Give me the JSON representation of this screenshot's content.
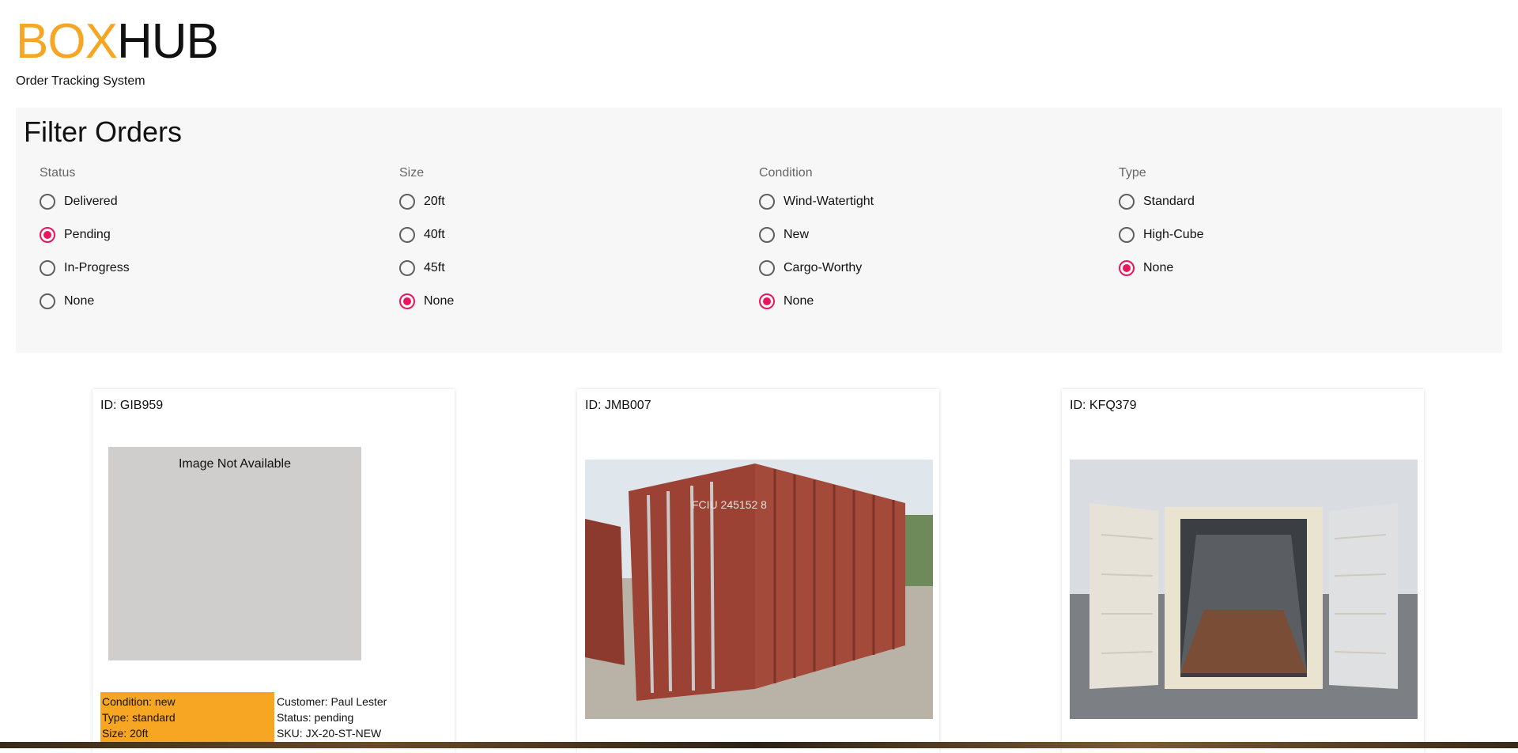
{
  "brand": {
    "logo_part1": "BOX",
    "logo_part2": "HUB",
    "subtitle": "Order Tracking System",
    "accent_color": "#f6a623"
  },
  "filters": {
    "title": "Filter Orders",
    "selected_color": "#e8175d",
    "groups": [
      {
        "label": "Status",
        "options": [
          "Delivered",
          "Pending",
          "In-Progress",
          "None"
        ],
        "selected": "Pending"
      },
      {
        "label": "Size",
        "options": [
          "20ft",
          "40ft",
          "45ft",
          "None"
        ],
        "selected": "None"
      },
      {
        "label": "Condition",
        "options": [
          "Wind-Watertight",
          "New",
          "Cargo-Worthy",
          "None"
        ],
        "selected": "None"
      },
      {
        "label": "Type",
        "options": [
          "Standard",
          "High-Cube",
          "None"
        ],
        "selected": "None"
      }
    ]
  },
  "orders": [
    {
      "id_label": "ID: GIB959",
      "image_placeholder": "Image Not Available",
      "condition": "Condition: new",
      "type": "Type: standard",
      "size": "Size: 20ft",
      "customer": "Customer: Paul Lester",
      "status": "Status: pending",
      "sku": "SKU: JX-20-ST-NEW"
    },
    {
      "id_label": "ID: JMB007",
      "image": "red-container-photo"
    },
    {
      "id_label": "ID: KFQ379",
      "image": "open-white-container-photo"
    }
  ]
}
